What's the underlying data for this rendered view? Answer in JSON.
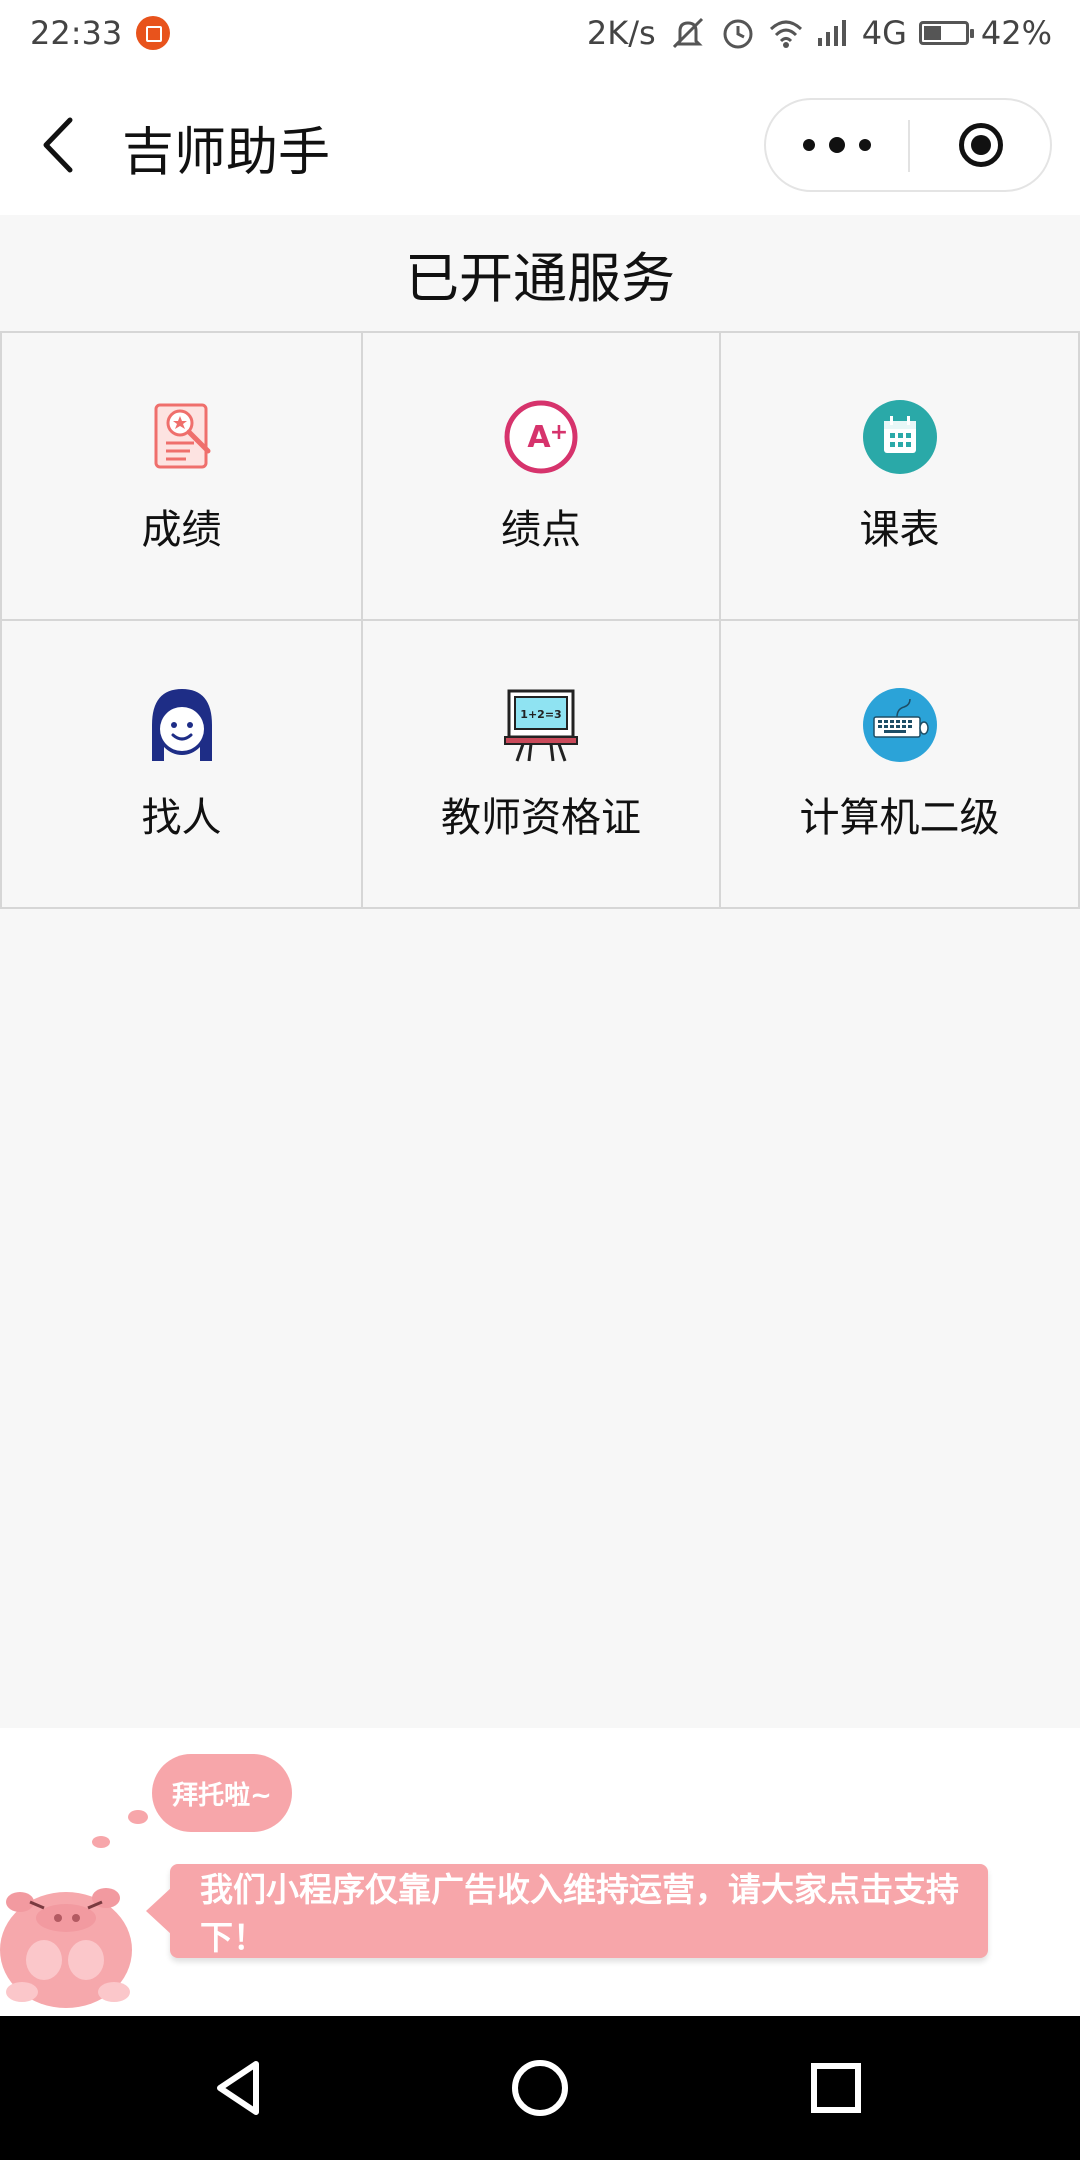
{
  "status_bar": {
    "time": "22:33",
    "network_speed": "2K/s",
    "network_type": "4G",
    "battery_percent": "42%",
    "battery_level": 0.42,
    "icons": [
      "app-notification-icon",
      "mute-icon",
      "alarm-icon",
      "wifi-icon",
      "signal-icon",
      "battery-icon"
    ]
  },
  "header": {
    "title": "吉师助手",
    "back_icon": "back-chevron-icon",
    "more_icon": "more-dots-icon",
    "close_icon": "miniprogram-close-icon"
  },
  "section": {
    "title": "已开通服务"
  },
  "services": [
    {
      "label": "成绩",
      "icon": "score-report-icon",
      "color": "#ef6f6c"
    },
    {
      "label": "绩点",
      "icon": "grade-a-plus-icon",
      "color": "#d6336c"
    },
    {
      "label": "课表",
      "icon": "calendar-icon",
      "color": "#2aa9a8"
    },
    {
      "label": "找人",
      "icon": "person-icon",
      "color": "#1e2d86"
    },
    {
      "label": "教师资格证",
      "icon": "blackboard-icon",
      "color": "#c94a5a",
      "icon_text": "1+2=3"
    },
    {
      "label": "计算机二级",
      "icon": "keyboard-icon",
      "color": "#2ba3d8"
    }
  ],
  "ad": {
    "bubble_text": "拜托啦~",
    "message": "我们小程序仅靠广告收入维持运营，请大家点击支持下！",
    "mascot_icon": "pink-pig-mascot-icon",
    "color": "#f7a6aa"
  },
  "nav_bar": {
    "icons": [
      "nav-back-icon",
      "nav-home-icon",
      "nav-recents-icon"
    ]
  }
}
